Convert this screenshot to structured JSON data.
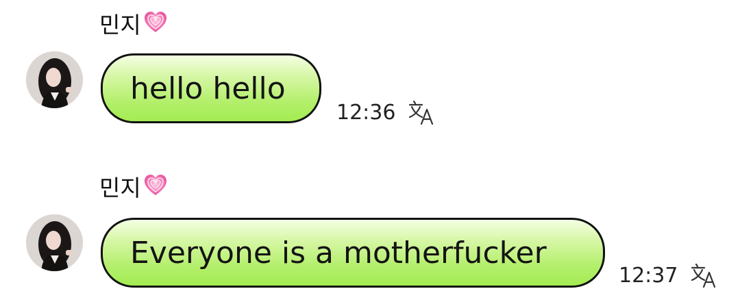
{
  "messages": [
    {
      "sender": "민지",
      "text": "hello hello",
      "time": "12:36"
    },
    {
      "sender": "민지",
      "text": "Everyone is a motherfucker",
      "time": "12:37"
    }
  ],
  "colors": {
    "bubble_top": "#f4ffe4",
    "bubble_bottom": "#a3ec52",
    "heart": "#f06aa8",
    "outline": "#111111"
  },
  "icons": {
    "heart": "sparkling-pink-heart-icon",
    "translate": "translate-icon"
  }
}
